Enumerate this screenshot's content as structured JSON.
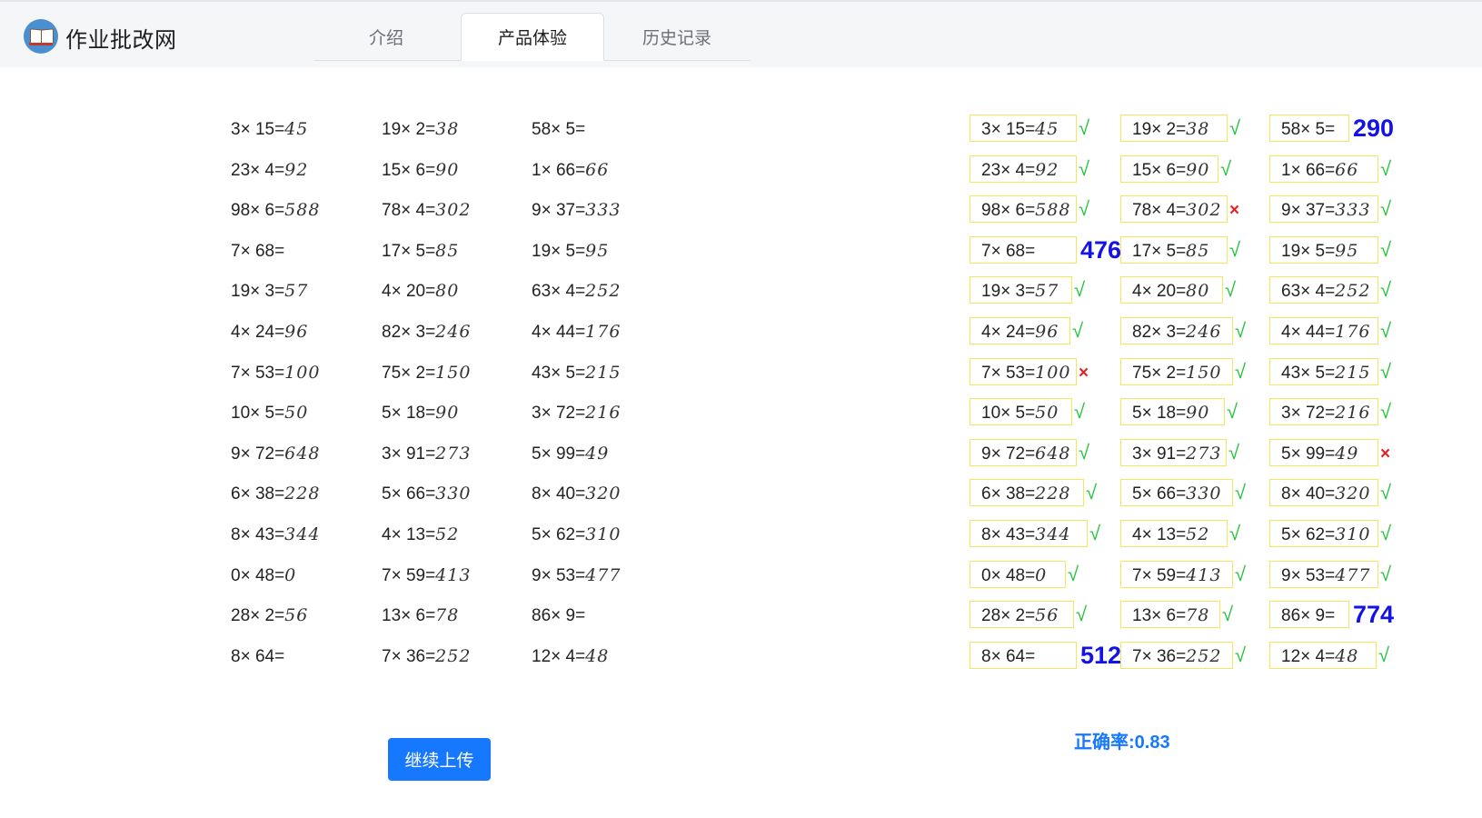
{
  "header": {
    "logo_icon": "open-book-icon",
    "title": "作业批改网",
    "tabs": [
      {
        "label": "介绍",
        "active": false
      },
      {
        "label": "产品体验",
        "active": true
      },
      {
        "label": "历史记录",
        "active": false
      }
    ]
  },
  "colors": {
    "accent": "#1677ff",
    "correct_mark": "#22c33a",
    "wrong_mark": "#e81f1f",
    "correction_text": "#1413e6",
    "box_outline": "#f2e85a"
  },
  "worksheet": {
    "columns": [
      [
        {
          "q": "3× 15=",
          "a": "45"
        },
        {
          "q": "23× 4=",
          "a": "92"
        },
        {
          "q": "98× 6=",
          "a": "588"
        },
        {
          "q": "7× 68=",
          "a": ""
        },
        {
          "q": "19× 3=",
          "a": "57"
        },
        {
          "q": "4× 24=",
          "a": "96"
        },
        {
          "q": "7× 53=",
          "a": "100"
        },
        {
          "q": "10× 5=",
          "a": "50"
        },
        {
          "q": "9× 72=",
          "a": "648"
        },
        {
          "q": "6× 38=",
          "a": "228"
        },
        {
          "q": "8× 43=",
          "a": "344"
        },
        {
          "q": "0× 48=",
          "a": "0"
        },
        {
          "q": "28× 2=",
          "a": "56"
        },
        {
          "q": "8× 64=",
          "a": ""
        }
      ],
      [
        {
          "q": "19× 2=",
          "a": "38"
        },
        {
          "q": "15× 6=",
          "a": "90"
        },
        {
          "q": "78× 4=",
          "a": "302"
        },
        {
          "q": "17× 5=",
          "a": "85"
        },
        {
          "q": "4× 20=",
          "a": "80"
        },
        {
          "q": "82× 3=",
          "a": "246"
        },
        {
          "q": "75× 2=",
          "a": "150"
        },
        {
          "q": "5× 18=",
          "a": "90"
        },
        {
          "q": "3× 91=",
          "a": "273"
        },
        {
          "q": "5× 66=",
          "a": "330"
        },
        {
          "q": "4× 13=",
          "a": "52"
        },
        {
          "q": "7× 59=",
          "a": "413"
        },
        {
          "q": "13× 6=",
          "a": "78"
        },
        {
          "q": "7× 36=",
          "a": "252"
        }
      ],
      [
        {
          "q": "58× 5=",
          "a": ""
        },
        {
          "q": "1× 66=",
          "a": "66"
        },
        {
          "q": "9× 37=",
          "a": "333"
        },
        {
          "q": "19× 5=",
          "a": "95"
        },
        {
          "q": "63× 4=",
          "a": "252"
        },
        {
          "q": "4× 44=",
          "a": "176"
        },
        {
          "q": "43× 5=",
          "a": "215"
        },
        {
          "q": "3× 72=",
          "a": "216"
        },
        {
          "q": "5× 99=",
          "a": "49"
        },
        {
          "q": "8× 40=",
          "a": "320"
        },
        {
          "q": "5× 62=",
          "a": "310"
        },
        {
          "q": "9× 53=",
          "a": "477"
        },
        {
          "q": "86× 9=",
          "a": ""
        },
        {
          "q": "12× 4=",
          "a": "48"
        }
      ]
    ]
  },
  "graded": {
    "columns": [
      [
        {
          "q": "3× 15=",
          "a": "45",
          "result": "correct",
          "mark": "√",
          "fix": ""
        },
        {
          "q": "23× 4=",
          "a": "92",
          "result": "correct",
          "mark": "√",
          "fix": ""
        },
        {
          "q": "98× 6=",
          "a": "588",
          "result": "correct",
          "mark": "√",
          "fix": ""
        },
        {
          "q": "7× 68=",
          "a": "",
          "result": "blank",
          "mark": "",
          "fix": "476"
        },
        {
          "q": "19× 3=",
          "a": "57",
          "result": "correct",
          "mark": "√",
          "fix": ""
        },
        {
          "q": "4× 24=",
          "a": "96",
          "result": "correct",
          "mark": "√",
          "fix": ""
        },
        {
          "q": "7× 53=",
          "a": "100",
          "result": "wrong",
          "mark": "×",
          "fix": ""
        },
        {
          "q": "10× 5=",
          "a": "50",
          "result": "correct",
          "mark": "√",
          "fix": ""
        },
        {
          "q": "9× 72=",
          "a": "648",
          "result": "correct",
          "mark": "√",
          "fix": ""
        },
        {
          "q": "6× 38=",
          "a": "228",
          "result": "correct",
          "mark": "√",
          "fix": ""
        },
        {
          "q": "8× 43=",
          "a": "344",
          "result": "correct",
          "mark": "√",
          "fix": ""
        },
        {
          "q": "0× 48=",
          "a": "0",
          "result": "correct",
          "mark": "√",
          "fix": ""
        },
        {
          "q": "28× 2=",
          "a": "56",
          "result": "correct",
          "mark": "√",
          "fix": ""
        },
        {
          "q": "8× 64=",
          "a": "",
          "result": "blank",
          "mark": "",
          "fix": "512"
        }
      ],
      [
        {
          "q": "19× 2=",
          "a": "38",
          "result": "correct",
          "mark": "√",
          "fix": ""
        },
        {
          "q": "15× 6=",
          "a": "90",
          "result": "correct",
          "mark": "√",
          "fix": ""
        },
        {
          "q": "78× 4=",
          "a": "302",
          "result": "wrong",
          "mark": "×",
          "fix": ""
        },
        {
          "q": "17× 5=",
          "a": "85",
          "result": "correct",
          "mark": "√",
          "fix": ""
        },
        {
          "q": "4× 20=",
          "a": "80",
          "result": "correct",
          "mark": "√",
          "fix": ""
        },
        {
          "q": "82× 3=",
          "a": "246",
          "result": "correct",
          "mark": "√",
          "fix": ""
        },
        {
          "q": "75× 2=",
          "a": "150",
          "result": "correct",
          "mark": "√",
          "fix": ""
        },
        {
          "q": "5× 18=",
          "a": "90",
          "result": "correct",
          "mark": "√",
          "fix": ""
        },
        {
          "q": "3× 91=",
          "a": "273",
          "result": "correct",
          "mark": "√",
          "fix": ""
        },
        {
          "q": "5× 66=",
          "a": "330",
          "result": "correct",
          "mark": "√",
          "fix": ""
        },
        {
          "q": "4× 13=",
          "a": "52",
          "result": "correct",
          "mark": "√",
          "fix": ""
        },
        {
          "q": "7× 59=",
          "a": "413",
          "result": "correct",
          "mark": "√",
          "fix": ""
        },
        {
          "q": "13× 6=",
          "a": "78",
          "result": "correct",
          "mark": "√",
          "fix": ""
        },
        {
          "q": "7× 36=",
          "a": "252",
          "result": "correct",
          "mark": "√",
          "fix": ""
        }
      ],
      [
        {
          "q": "58× 5=",
          "a": "",
          "result": "blank",
          "mark": "",
          "fix": "290"
        },
        {
          "q": "1× 66=",
          "a": "66",
          "result": "correct",
          "mark": "√",
          "fix": ""
        },
        {
          "q": "9× 37=",
          "a": "333",
          "result": "correct",
          "mark": "√",
          "fix": ""
        },
        {
          "q": "19× 5=",
          "a": "95",
          "result": "correct",
          "mark": "√",
          "fix": ""
        },
        {
          "q": "63× 4=",
          "a": "252",
          "result": "correct",
          "mark": "√",
          "fix": ""
        },
        {
          "q": "4× 44=",
          "a": "176",
          "result": "correct",
          "mark": "√",
          "fix": ""
        },
        {
          "q": "43× 5=",
          "a": "215",
          "result": "correct",
          "mark": "√",
          "fix": ""
        },
        {
          "q": "3× 72=",
          "a": "216",
          "result": "correct",
          "mark": "√",
          "fix": ""
        },
        {
          "q": "5× 99=",
          "a": "49",
          "result": "wrong",
          "mark": "×",
          "fix": ""
        },
        {
          "q": "8× 40=",
          "a": "320",
          "result": "correct",
          "mark": "√",
          "fix": ""
        },
        {
          "q": "5× 62=",
          "a": "310",
          "result": "correct",
          "mark": "√",
          "fix": ""
        },
        {
          "q": "9× 53=",
          "a": "477",
          "result": "correct",
          "mark": "√",
          "fix": ""
        },
        {
          "q": "86× 9=",
          "a": "",
          "result": "blank",
          "mark": "",
          "fix": "774"
        },
        {
          "q": "12× 4=",
          "a": "48",
          "result": "correct",
          "mark": "√",
          "fix": ""
        }
      ]
    ]
  },
  "actions": {
    "upload_label": "继续上传"
  },
  "accuracy_text": "正确率:0.83"
}
